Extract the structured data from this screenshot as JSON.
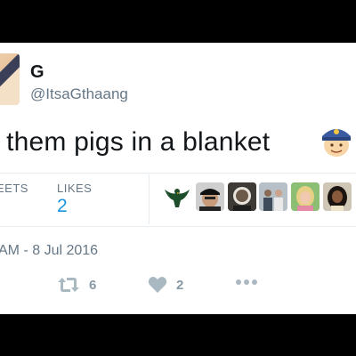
{
  "user": {
    "display_name": "G",
    "handle": "@ItsaGthaang"
  },
  "tweet": {
    "text": "t them pigs in a blanket",
    "emoji": "police-officer-emoji",
    "timestamp": "AM - 8 Jul 2016"
  },
  "stats": {
    "retweets_label": "EETS",
    "likes_label": "LIKES",
    "likes_value": "2"
  },
  "likers": [
    {
      "icon": "eagle-avatar"
    },
    {
      "icon": "man-cap-avatar"
    },
    {
      "icon": "dark-avatar"
    },
    {
      "icon": "group-avatar"
    },
    {
      "icon": "blonde-avatar"
    },
    {
      "icon": "woman-avatar"
    }
  ],
  "actions": {
    "retweet_count": "6",
    "like_count": "2"
  },
  "colors": {
    "link": "#1b95e0",
    "muted": "#657786",
    "action_gray": "#aab8c2"
  }
}
